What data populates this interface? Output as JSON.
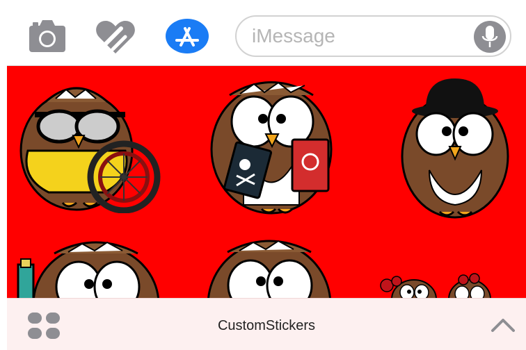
{
  "compose": {
    "placeholder": "iMessage",
    "icons": [
      "camera-icon",
      "heart-apps-icon",
      "app-store-icon",
      "microphone-icon"
    ]
  },
  "drawer": {
    "background": "#ff0000",
    "stickers": [
      "owl-cyclist",
      "owl-books",
      "owl-bowler-hat",
      "owl-tube",
      "owl-plain",
      "owl-pair-roses"
    ]
  },
  "bottom_bar": {
    "app_name": "CustomStickers",
    "icons": [
      "app-grid-icon",
      "chevron-up-icon"
    ]
  },
  "colors": {
    "accent_blue": "#1a7cf5",
    "icon_gray": "#8e8e93",
    "owl_brown": "#7a4a2a",
    "sticker_bg": "#ff0000"
  }
}
